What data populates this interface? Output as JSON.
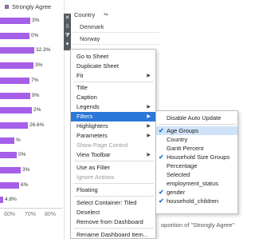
{
  "legend": {
    "label": "Strongly Agree",
    "color": "#a55fe8"
  },
  "bars": [
    {
      "label": "3%",
      "value": 0.48
    },
    {
      "label": "0%",
      "value": 0.46
    },
    {
      "label": "32.3%",
      "value": 0.54
    },
    {
      "label": "3%",
      "value": 0.52
    },
    {
      "label": "7%",
      "value": 0.46
    },
    {
      "label": "9%",
      "value": 0.48
    },
    {
      "label": "2%",
      "value": 0.5
    },
    {
      "label": "26.6%",
      "value": 0.44
    },
    {
      "label": "%",
      "value": 0.22
    },
    {
      "label": "0%",
      "value": 0.26
    },
    {
      "label": "3%",
      "value": 0.32
    },
    {
      "label": "6%",
      "value": 0.3
    },
    {
      "label": "4.8%",
      "value": 0.048
    }
  ],
  "x_axis": {
    "ticks": [
      "60%",
      "70%",
      "80%"
    ],
    "title": "oportion of \"Strongly Agree\""
  },
  "country_filter": {
    "title": "Country",
    "items": [
      "Denmark",
      "Norway"
    ]
  },
  "toolstrip": {
    "close": "✕",
    "move": "⇩",
    "filter": "⧩",
    "more": "▾"
  },
  "context_menu": {
    "items": [
      "Go to Sheet",
      "Duplicate Sheet",
      "Fit",
      "Title",
      "Caption",
      "Legends",
      "Filters",
      "Highlighters",
      "Parameters",
      "Show Page Control",
      "View Toolbar",
      "Use as Filter",
      "Ignore Actions",
      "Floating",
      "Select Container: Tiled",
      "Deselect",
      "Remove from Dashboard",
      "Rename Dashboard Item..."
    ]
  },
  "filters_submenu": {
    "header": "Disable Auto Update",
    "items": [
      {
        "label": "Age Groups",
        "checked": true
      },
      {
        "label": "Country",
        "checked": false
      },
      {
        "label": "Gantt Percent",
        "checked": false
      },
      {
        "label": "Household Size Groups",
        "checked": true
      },
      {
        "label": "Percentage",
        "checked": false
      },
      {
        "label": "Selected",
        "checked": false
      },
      {
        "label": "employment_status",
        "checked": false
      },
      {
        "label": "gender",
        "checked": true
      },
      {
        "label": "household_children",
        "checked": true
      }
    ]
  },
  "colors": {
    "accent": "#2b78d8",
    "hover": "#cfe2f7",
    "bar": "#a55fe8",
    "toolstrip": "#555a60"
  }
}
